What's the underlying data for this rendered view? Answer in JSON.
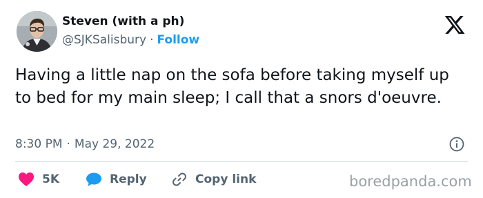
{
  "author": {
    "display_name": "Steven (with a ph)",
    "handle": "@SJKSalisbury",
    "separator": "·",
    "follow_label": "Follow"
  },
  "tweet": {
    "text": "Having a little nap on the sofa before taking myself up to bed for my main sleep; I call that a snors d'oeuvre.",
    "time": "8:30 PM",
    "separator": "·",
    "date": "May 29, 2022"
  },
  "actions": {
    "like_count": "5K",
    "reply_label": "Reply",
    "copy_link_label": "Copy link"
  },
  "watermark": "boredpanda.com",
  "icons": {
    "platform_logo": "x-logo-icon",
    "info": "info-icon",
    "like": "heart-icon",
    "reply": "speech-bubble-icon",
    "copy_link": "link-icon"
  },
  "colors": {
    "accent": "#1d9bf0",
    "like": "#f91880",
    "text": "#0f1419",
    "muted": "#536471",
    "divider": "#cfd9de"
  }
}
